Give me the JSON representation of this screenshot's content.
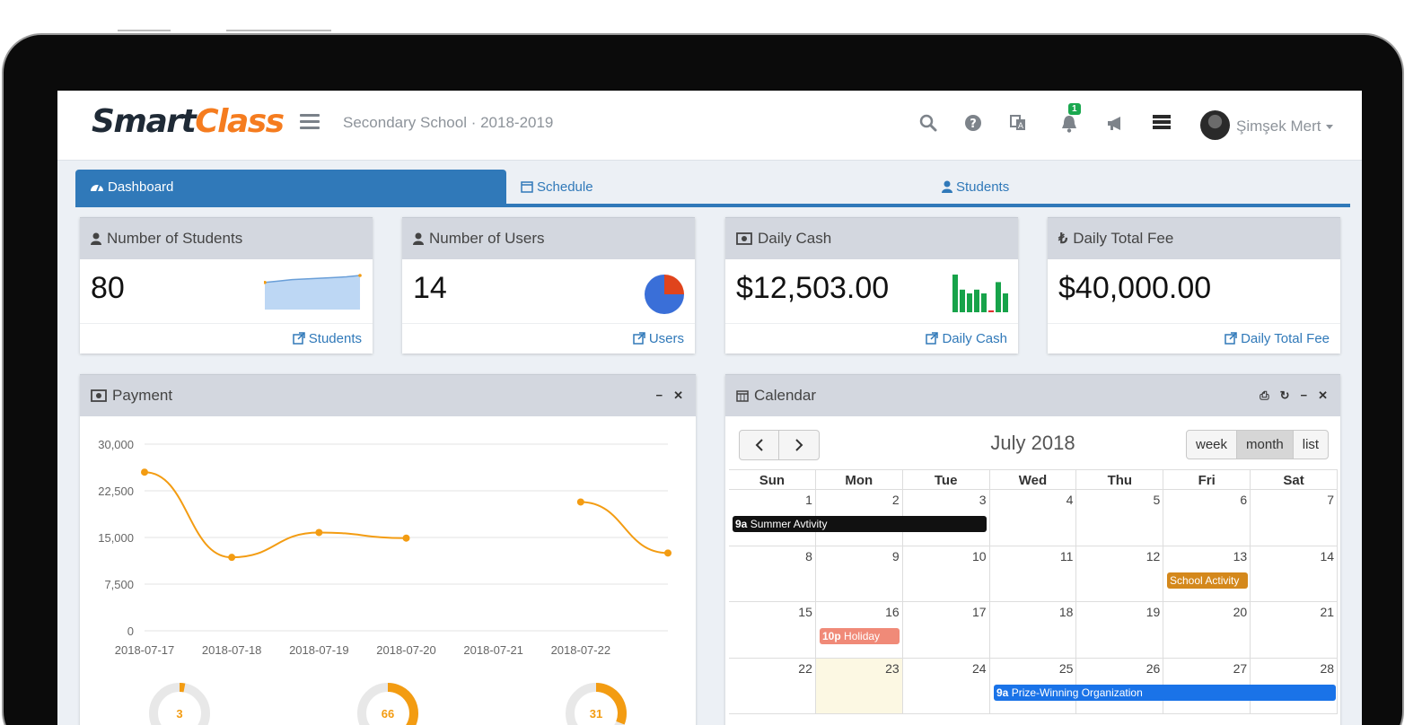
{
  "app": {
    "logo_part1": "Smart",
    "logo_part2": "Class",
    "school": "Secondary School · 2018-2019"
  },
  "header": {
    "notifications_count": "1",
    "user_name": "Şimşek Mert"
  },
  "tabs": [
    {
      "label": "Dashboard",
      "active": true
    },
    {
      "label": "Schedule",
      "active": false
    },
    {
      "label": "Students",
      "active": false
    }
  ],
  "stats": [
    {
      "title": "Number of Students",
      "value": "80",
      "link": "Students",
      "spark_values": [
        70,
        72,
        74,
        75,
        76,
        77,
        78,
        80
      ]
    },
    {
      "title": "Number of Users",
      "value": "14",
      "link": "Users",
      "pie": [
        {
          "value": 75,
          "color": "#3a6fd8"
        },
        {
          "value": 25,
          "color": "#e0441c"
        }
      ]
    },
    {
      "title": "Daily Cash",
      "value": "$12,503.00",
      "link": "Daily Cash",
      "bars": [
        10,
        6,
        5,
        6,
        5,
        0.5,
        8,
        5
      ]
    },
    {
      "title": "Daily Total Fee",
      "value": "$40,000.00",
      "link": "Daily Total Fee"
    }
  ],
  "payment": {
    "title": "Payment",
    "chart_data": {
      "type": "line",
      "categories": [
        "2018-07-17",
        "2018-07-18",
        "2018-07-19",
        "2018-07-20",
        "2018-07-21",
        "2018-07-22",
        ""
      ],
      "series": [
        {
          "values": [
            25500,
            11800,
            15800,
            14900,
            null,
            20700,
            12500
          ]
        }
      ],
      "yticks": [
        "0",
        "7,500",
        "15,000",
        "22,500",
        "30,000"
      ],
      "ylim": [
        0,
        30000
      ],
      "grid": true
    },
    "donuts": [
      {
        "value": "3",
        "percent": 3
      },
      {
        "value": "66",
        "percent": 66
      },
      {
        "value": "31",
        "percent": 31
      }
    ]
  },
  "calendar": {
    "title": "Calendar",
    "month_label": "July 2018",
    "views": [
      "week",
      "month",
      "list"
    ],
    "active_view": "month",
    "weekdays": [
      "Sun",
      "Mon",
      "Tue",
      "Wed",
      "Thu",
      "Fri",
      "Sat"
    ],
    "weeks": [
      [
        "1",
        "2",
        "3",
        "4",
        "5",
        "6",
        "7"
      ],
      [
        "8",
        "9",
        "10",
        "11",
        "12",
        "13",
        "14"
      ],
      [
        "15",
        "16",
        "17",
        "18",
        "19",
        "20",
        "21"
      ],
      [
        "22",
        "23",
        "24",
        "25",
        "26",
        "27",
        "28"
      ]
    ],
    "today": "23",
    "events": [
      {
        "time": "9a",
        "title": "Summer Avtivity",
        "color": "#111111"
      },
      {
        "time": "",
        "title": "School Activity",
        "color": "#d4881c"
      },
      {
        "time": "10p",
        "title": "Holiday",
        "color": "#f08a78"
      },
      {
        "time": "9a",
        "title": "Prize-Winning Organization",
        "color": "#1a73e8"
      }
    ]
  }
}
